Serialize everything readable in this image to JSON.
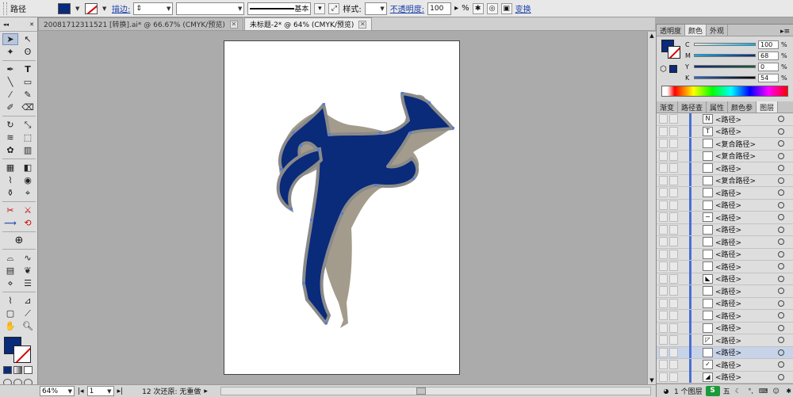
{
  "control_bar": {
    "selection_label": "路径",
    "fill_color": "#0a2a7a",
    "stroke_label": "描边:",
    "stroke_weight": "",
    "stroke_style": "基本",
    "style_label": "样式:",
    "opacity_label": "不透明度:",
    "opacity_value": "100",
    "opacity_unit": "%",
    "transform_label": "变换"
  },
  "doc_tabs": [
    {
      "label": "20081712311521 [转换].ai* @ 66.67% (CMYK/预览)",
      "active": false
    },
    {
      "label": "未标题-2* @ 64% (CMYK/预览)",
      "active": true
    }
  ],
  "toolbox": {
    "tools": [
      "selection-tool",
      "direct-selection-tool",
      "magic-wand-tool",
      "lasso-tool",
      "pen-tool",
      "type-tool",
      "line-tool",
      "rectangle-tool",
      "paintbrush-tool",
      "pencil-tool",
      "blob-brush-tool",
      "eraser-tool",
      "rotate-tool",
      "scale-tool",
      "warp-tool",
      "free-transform-tool",
      "symbol-sprayer-tool",
      "column-graph-tool",
      "mesh-tool",
      "gradient-tool",
      "eyedropper-tool",
      "blend-tool",
      "live-paint-bucket-tool",
      "live-paint-selection-tool",
      "crop-tool",
      "slice-tool",
      "hand-tool",
      "zoom-tool"
    ]
  },
  "color_panel": {
    "tabs": [
      "透明度",
      "颜色",
      "外观"
    ],
    "active_tab": "颜色",
    "channels": [
      {
        "name": "C",
        "value": "100",
        "color": "#00aeef"
      },
      {
        "name": "M",
        "value": "68",
        "color": "#ec008c"
      },
      {
        "name": "Y",
        "value": "0",
        "color": "#fff200"
      },
      {
        "name": "K",
        "value": "54",
        "color": "#000000"
      }
    ],
    "unit": "%"
  },
  "layers_panel": {
    "tabs": [
      "渐变",
      "路径查",
      "属性",
      "颜色参",
      "图层"
    ],
    "active_tab": "图层",
    "rows": [
      {
        "name": "<路径>"
      },
      {
        "name": "<路径>"
      },
      {
        "name": "<复合路径>"
      },
      {
        "name": "<复合路径>"
      },
      {
        "name": "<路径>"
      },
      {
        "name": "<复合路径>"
      },
      {
        "name": "<路径>"
      },
      {
        "name": "<路径>"
      },
      {
        "name": "<路径>"
      },
      {
        "name": "<路径>"
      },
      {
        "name": "<路径>"
      },
      {
        "name": "<路径>"
      },
      {
        "name": "<路径>"
      },
      {
        "name": "<路径>"
      },
      {
        "name": "<路径>"
      },
      {
        "name": "<路径>"
      },
      {
        "name": "<路径>"
      },
      {
        "name": "<路径>"
      },
      {
        "name": "<路径>"
      },
      {
        "name": "<路径>"
      },
      {
        "name": "<路径>"
      },
      {
        "name": "<路径>"
      }
    ],
    "footer_text": "1 个图层",
    "ime_label": "五"
  },
  "status_bar": {
    "zoom": "64%",
    "artboard": "1",
    "undo_status": "12 次还原: 无重做"
  },
  "artwork": {
    "fill": "#0a2a7a",
    "shadow": "#a39c8c",
    "anchor_color": "#4a7df0"
  }
}
